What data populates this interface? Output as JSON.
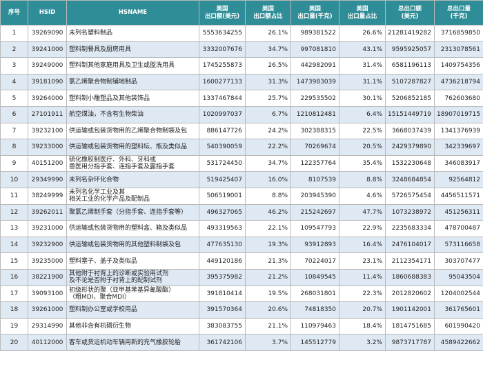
{
  "headers": {
    "seq": "序号",
    "hsid": "HSID",
    "hsname": "HSNAME",
    "us_export_value": "美国\n出口额(美元)",
    "us_export_value_share": "美国\n出口额占比",
    "us_export_qty": "美国\n出口量(千克)",
    "us_export_qty_share": "美国\n出口量占比",
    "total_export_value": "总出口额\n(美元)",
    "total_export_qty": "总出口量\n(千克)"
  },
  "rows": [
    {
      "seq": "1",
      "hsid": "39269090",
      "name": "未列名塑料制品",
      "us_value": "5553634255",
      "us_value_share": "26.1%",
      "us_qty": "989381522",
      "us_qty_share": "26.6%",
      "total_value": "21281419282",
      "total_qty": "3716859850"
    },
    {
      "seq": "2",
      "hsid": "39241000",
      "name": "塑料制餐具及厨房用具",
      "us_value": "3332007676",
      "us_value_share": "34.7%",
      "us_qty": "997081810",
      "us_qty_share": "43.1%",
      "total_value": "9595925057",
      "total_qty": "2313078561"
    },
    {
      "seq": "3",
      "hsid": "39249000",
      "name": "塑料制其他家庭用具及卫生或盥洗用具",
      "us_value": "1745255873",
      "us_value_share": "26.5%",
      "us_qty": "442982091",
      "us_qty_share": "31.4%",
      "total_value": "6581196113",
      "total_qty": "1409754356"
    },
    {
      "seq": "4",
      "hsid": "39181090",
      "name": "氯乙烯聚合物制铺地制品",
      "us_value": "1600277133",
      "us_value_share": "31.3%",
      "us_qty": "1473983039",
      "us_qty_share": "31.1%",
      "total_value": "5107287827",
      "total_qty": "4736218794"
    },
    {
      "seq": "5",
      "hsid": "39264000",
      "name": "塑料制小雕塑品及其他装饰品",
      "us_value": "1337467844",
      "us_value_share": "25.7%",
      "us_qty": "229535502",
      "us_qty_share": "30.1%",
      "total_value": "5206852185",
      "total_qty": "762603680"
    },
    {
      "seq": "6",
      "hsid": "27101911",
      "name": "航空煤油，不含有生物柴油",
      "us_value": "1020997037",
      "us_value_share": "6.7%",
      "us_qty": "1210812481",
      "us_qty_share": "6.4%",
      "total_value": "15151449719",
      "total_qty": "18907019715"
    },
    {
      "seq": "7",
      "hsid": "39232100",
      "name": "供运输或包装货物用的乙烯聚合物制袋及包",
      "us_value": "886147726",
      "us_value_share": "24.2%",
      "us_qty": "302388315",
      "us_qty_share": "22.5%",
      "total_value": "3668037439",
      "total_qty": "1341376939"
    },
    {
      "seq": "8",
      "hsid": "39233000",
      "name": "供运输或包装货物用的塑料坛、瓶及类似品",
      "us_value": "540390059",
      "us_value_share": "22.2%",
      "us_qty": "70269674",
      "us_qty_share": "20.5%",
      "total_value": "2429379890",
      "total_qty": "342339697"
    },
    {
      "seq": "9",
      "hsid": "40151200",
      "name": "硫化橡胶制医疗、外科、牙科或\n兽医用分指手套、连指手套及露指手套",
      "us_value": "531724450",
      "us_value_share": "34.7%",
      "us_qty": "122357764",
      "us_qty_share": "35.4%",
      "total_value": "1532230648",
      "total_qty": "346083917"
    },
    {
      "seq": "10",
      "hsid": "29349990",
      "name": "未列名杂环化合物",
      "us_value": "519425407",
      "us_value_share": "16.0%",
      "us_qty": "8107539",
      "us_qty_share": "8.8%",
      "total_value": "3248684854",
      "total_qty": "92564812"
    },
    {
      "seq": "11",
      "hsid": "38249999",
      "name": "未列名化学工业及其\n相关工业的化学产品及配制品",
      "us_value": "506519001",
      "us_value_share": "8.8%",
      "us_qty": "203945390",
      "us_qty_share": "4.6%",
      "total_value": "5726575454",
      "total_qty": "4456511571"
    },
    {
      "seq": "12",
      "hsid": "39262011",
      "name": "聚氯乙烯制手套（分指手套、连指手套等）",
      "us_value": "496327065",
      "us_value_share": "46.2%",
      "us_qty": "215242697",
      "us_qty_share": "47.7%",
      "total_value": "1073238972",
      "total_qty": "451256311"
    },
    {
      "seq": "13",
      "hsid": "39231000",
      "name": "供运输或包装货物用的塑料盒、箱及类似品",
      "us_value": "493319563",
      "us_value_share": "22.1%",
      "us_qty": "109547793",
      "us_qty_share": "22.9%",
      "total_value": "2235683334",
      "total_qty": "478700487"
    },
    {
      "seq": "14",
      "hsid": "39232900",
      "name": "供运输或包装货物用的其他塑料制袋及包",
      "us_value": "477635130",
      "us_value_share": "19.3%",
      "us_qty": "93912893",
      "us_qty_share": "16.4%",
      "total_value": "2476104017",
      "total_qty": "573116658"
    },
    {
      "seq": "15",
      "hsid": "39235000",
      "name": "塑料塞子、盖子及类似品",
      "us_value": "449120186",
      "us_value_share": "21.3%",
      "us_qty": "70224017",
      "us_qty_share": "23.1%",
      "total_value": "2112354171",
      "total_qty": "303707477"
    },
    {
      "seq": "16",
      "hsid": "38221900",
      "name": "其他附于衬背上的诊断或实验用试剂\n及不论是否附于衬背上的配制试剂",
      "us_value": "395375982",
      "us_value_share": "21.2%",
      "us_qty": "10849545",
      "us_qty_share": "11.4%",
      "total_value": "1860688383",
      "total_qty": "95043504"
    },
    {
      "seq": "17",
      "hsid": "39093100",
      "name": "初级形状的聚（亚甲基苯基异氰酸酯）\n（粗MDI、聚合MDI）",
      "us_value": "391810414",
      "us_value_share": "19.5%",
      "us_qty": "268031801",
      "us_qty_share": "22.3%",
      "total_value": "2012820602",
      "total_qty": "1204002544"
    },
    {
      "seq": "18",
      "hsid": "39261000",
      "name": "塑料制办公室或学校用品",
      "us_value": "391570364",
      "us_value_share": "20.6%",
      "us_qty": "74818350",
      "us_qty_share": "20.7%",
      "total_value": "1901142001",
      "total_qty": "361765601"
    },
    {
      "seq": "19",
      "hsid": "29314990",
      "name": "其他非含有机磷衍生物",
      "us_value": "383083755",
      "us_value_share": "21.1%",
      "us_qty": "110979463",
      "us_qty_share": "18.4%",
      "total_value": "1814751685",
      "total_qty": "601990420"
    },
    {
      "seq": "20",
      "hsid": "40112000",
      "name": "客车或货运机动车辆用新的充气橡胶轮胎",
      "us_value": "361742106",
      "us_value_share": "3.7%",
      "us_qty": "145512779",
      "us_qty_share": "3.2%",
      "total_value": "9873717787",
      "total_qty": "4589422662"
    }
  ]
}
